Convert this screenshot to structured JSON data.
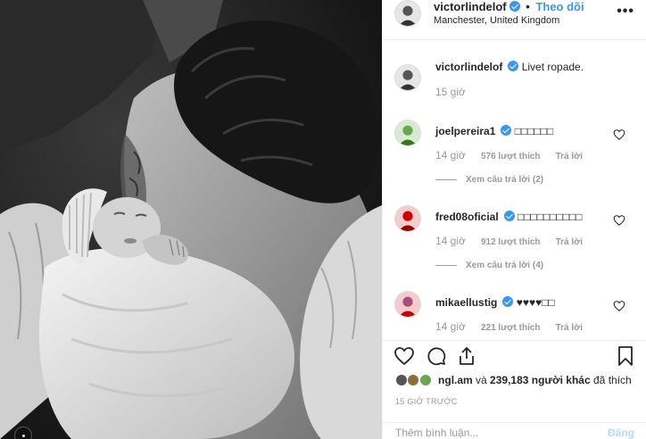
{
  "header": {
    "username": "victorlindelof",
    "separator": "•",
    "follow_label": "Theo dõi",
    "location": "Manchester, United Kingdom",
    "more_label": "•••"
  },
  "caption": {
    "username": "victorlindelof",
    "text": "Livet ropade.",
    "time": "15 giờ"
  },
  "comments": [
    {
      "username": "joelpereira1",
      "text": "□□□□□□",
      "time": "14 giờ",
      "likes": "576 lượt thích",
      "reply": "Trả lời",
      "view_replies": "Xem câu trả lời (2)"
    },
    {
      "username": "fred08oficial",
      "text": "□□□□□□□□□□",
      "time": "14 giờ",
      "likes": "912 lượt thích",
      "reply": "Trả lời",
      "view_replies": "Xem câu trả lời (4)"
    },
    {
      "username": "mikaellustig",
      "text": "♥♥♥♥□□",
      "time": "14 giờ",
      "likes": "221 lượt thích",
      "reply": "Trả lời"
    }
  ],
  "likes": {
    "user": "ngl.am",
    "middle": " và ",
    "count": "239,183 người khác",
    "suffix": " đã thích"
  },
  "time_ago": "15 GIỜ TRƯỚC",
  "add_comment": {
    "placeholder": "Thêm bình luận...",
    "post_label": "Đăng"
  },
  "colors": {
    "accent": "#3897f0",
    "meta_text": "#999999",
    "border": "#efefef"
  },
  "icons": [
    "heart-icon",
    "comment-icon",
    "share-icon",
    "bookmark-icon",
    "verified-icon",
    "more-options-icon"
  ]
}
